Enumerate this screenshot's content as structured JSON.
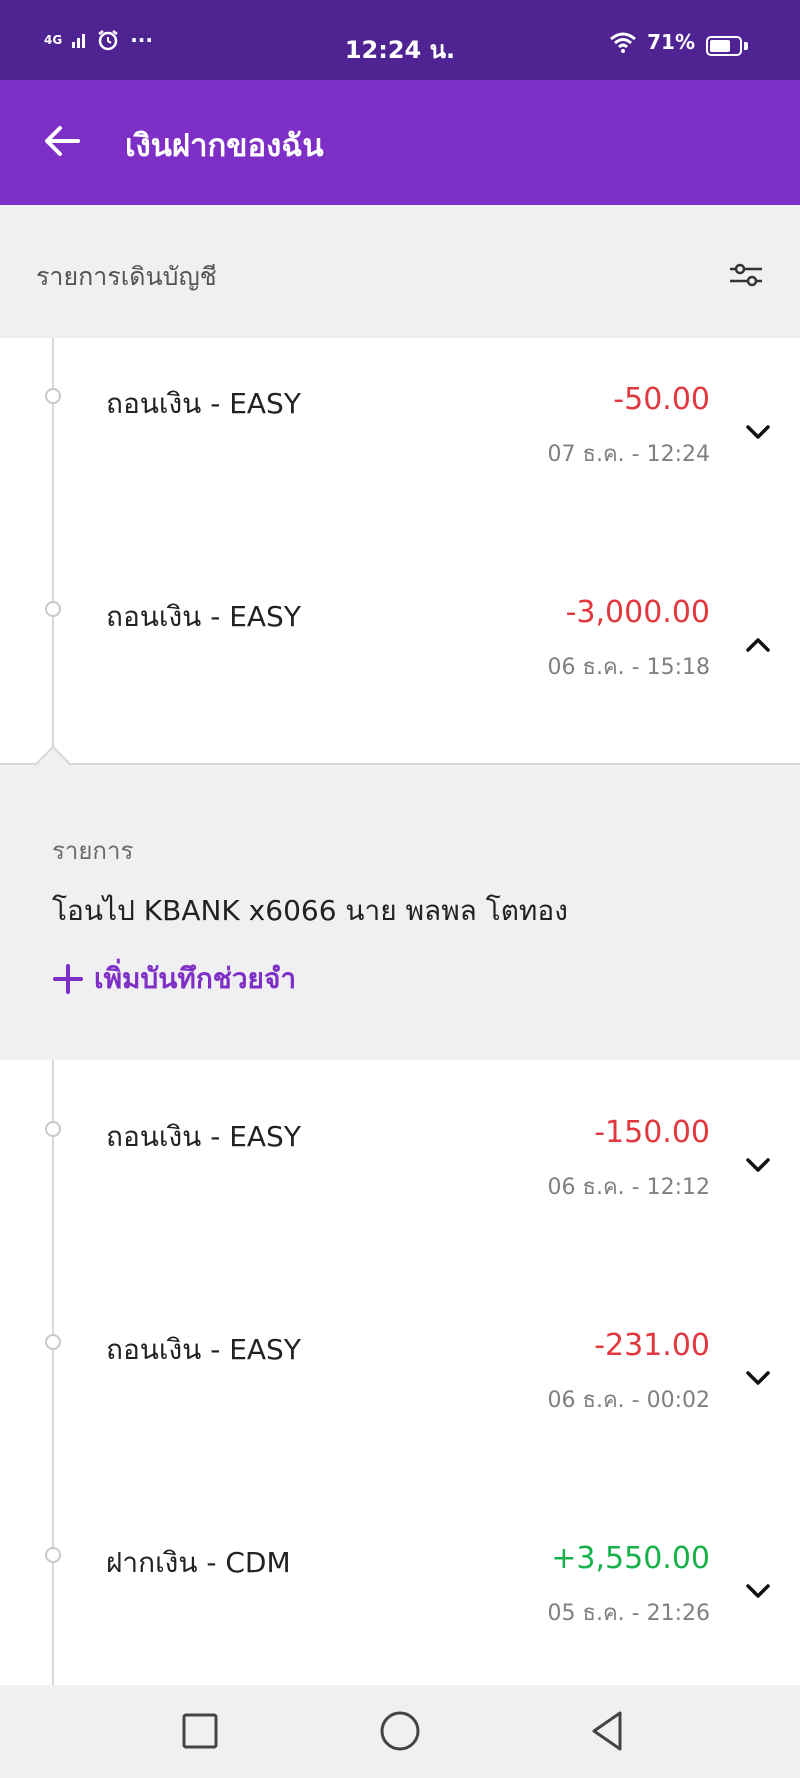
{
  "status_bar": {
    "network": "4G",
    "dots": "···",
    "time": "12:24 น.",
    "battery": "71%",
    "battery_level": 0.71
  },
  "app_bar": {
    "title": "เงินฝากของฉัน"
  },
  "section": {
    "title": "รายการเดินบัญชี"
  },
  "transactions": [
    {
      "title": "ถอนเงิน - EASY",
      "amount": "-50.00",
      "date": "07 ธ.ค. - 12:24",
      "type": "debit",
      "expanded": false
    },
    {
      "title": "ถอนเงิน - EASY",
      "amount": "-3,000.00",
      "date": "06 ธ.ค. - 15:18",
      "type": "debit",
      "expanded": true
    },
    {
      "title": "ถอนเงิน - EASY",
      "amount": "-150.00",
      "date": "06 ธ.ค. - 12:12",
      "type": "debit",
      "expanded": false
    },
    {
      "title": "ถอนเงิน - EASY",
      "amount": "-231.00",
      "date": "06 ธ.ค. - 00:02",
      "type": "debit",
      "expanded": false
    },
    {
      "title": "ฝากเงิน - CDM",
      "amount": "+3,550.00",
      "date": "05 ธ.ค. - 21:26",
      "type": "credit",
      "expanded": false
    }
  ],
  "detail": {
    "label": "รายการ",
    "value": "โอนไป KBANK x6066 นาย พลพล โตทอง",
    "add_note": "เพิ่มบันทึกช่วยจำ"
  },
  "colors": {
    "status_bar": "#4f2492",
    "app_bar": "#7e2fc6",
    "debit": "#e0383e",
    "credit": "#17b14a",
    "accent": "#7e2fc6"
  }
}
